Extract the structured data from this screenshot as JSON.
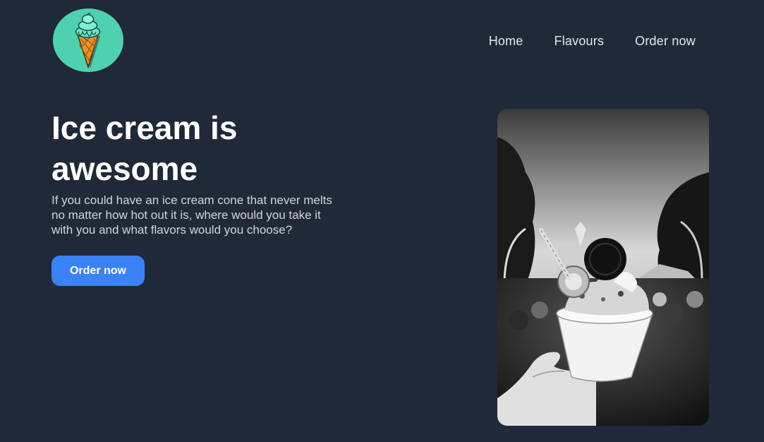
{
  "header": {
    "logo": {
      "icon": "ice-cream-cone-icon",
      "background": "#4fd1b0"
    },
    "nav": [
      {
        "label": "Home"
      },
      {
        "label": "Flavours"
      },
      {
        "label": "Order now"
      }
    ]
  },
  "hero": {
    "title": "Ice cream is awesome",
    "description": "If you could have an ice cream cone that never melts no matter how hot out it is, where would you take it with you and what flavors would you choose?",
    "cta_label": "Order now",
    "cta_color": "#3b82f6",
    "image": {
      "subject": "ice-cream-cup-photo",
      "style": "black-and-white"
    }
  },
  "colors": {
    "background": "#1f2937",
    "text": "#e5e7eb",
    "accent": "#3b82f6"
  }
}
